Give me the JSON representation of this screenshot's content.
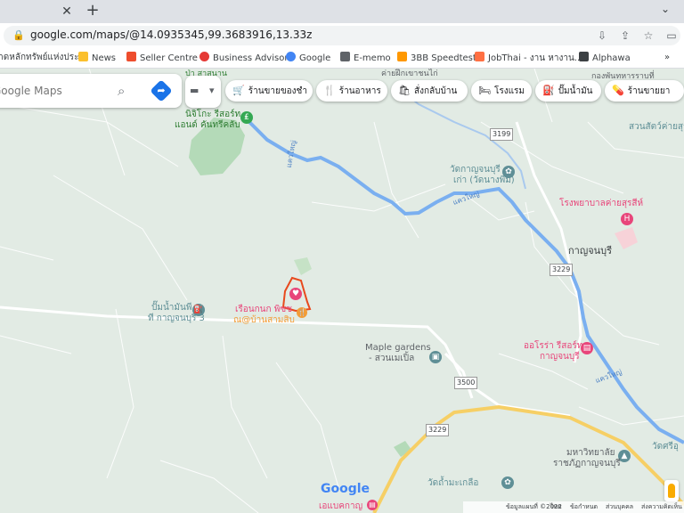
{
  "browser": {
    "tab_close_icon": "close-icon",
    "new_tab_label": "+",
    "tab_menu_label": "⌄",
    "url": "google.com/maps/@14.0935345,99.3683916,13.33z"
  },
  "bookmarks": [
    {
      "label": "ลาดหลักทรัพย์แห่งประ...",
      "color": "#1a73e8"
    },
    {
      "label": "News",
      "color": "#fbc02d"
    },
    {
      "label": "Seller Centre",
      "color": "#ee4d2d"
    },
    {
      "label": "Business Advisor",
      "color": "#e53935"
    },
    {
      "label": "Google",
      "color": "#4285f4"
    },
    {
      "label": "E-memo",
      "color": "#5f6368"
    },
    {
      "label": "3BB Speedtest",
      "color": "#ff9800"
    },
    {
      "label": "JobThai - งาน หางาน...",
      "color": "#ff7043"
    },
    {
      "label": "Alphawa",
      "color": "#3c4043"
    }
  ],
  "bookmarks_more": "»",
  "search": {
    "placeholder": "Google Maps"
  },
  "keyboard": {
    "label": "▬",
    "caret": "▾"
  },
  "chips": [
    {
      "label": "ร้านขายของชำ",
      "icon": "🛒"
    },
    {
      "label": "ร้านอาหาร",
      "icon": "🍴"
    },
    {
      "label": "สั่งกลับบ้าน",
      "icon": "🛍"
    },
    {
      "label": "โรงแรม",
      "icon": "🛏"
    },
    {
      "label": "ปั๊มน้ำมัน",
      "icon": "⛽"
    },
    {
      "label": "ร้านขายยา",
      "icon": "💊"
    }
  ],
  "map_labels": {
    "nichiko_1": "นิจิโกะ รีสอร์ท",
    "nichiko_2": "แอนด์ คันทรีคลับ",
    "river_1": "แควใหญ่",
    "river_2": "แควใหญ่",
    "river_3": "แควใหญ่",
    "wat_1": "วัดกาญจนบุรี",
    "wat_2": "เก่า (วัดนางพิม)",
    "camp": "ค่ายฝึกเขาชนไก่",
    "reg": "กองพันทหารราบที่",
    "zoo": "สวนสัตว์ค่ายสุร",
    "hospital": "โรงพยาบาลค่ายสุรสีห์",
    "town": "กาญจนบุรี",
    "pump_1": "ปั๊มน้ำมันพี",
    "pump_2": "ที กาญจนบุรี 3",
    "home_1": "เรือนกนก พิซซ",
    "home_2": "ณ@บ้านสามสิบ",
    "maple_1": "Maple gardens",
    "maple_2": "- สวนเมเปิ้ล",
    "aura_1": "ออโรร่า รีสอร์ท",
    "aura_2": "กาญจนบุรี",
    "uni_1": "มหาวิทยาลัย",
    "uni_2": "ราชภัฏกาญจนบุรี",
    "wat_thammakhelo": "วัดถ้ำมะเกลือ",
    "wat_sri": "วัดศรีอุ",
    "top_partial": "ป่า สาสนาน",
    "bottom_partial": "เอแบคกาญ",
    "road_3199": "3199",
    "road_3229_a": "3229",
    "road_3500": "3500",
    "road_3229_b": "3229"
  },
  "google_logo": "Google",
  "footer": {
    "data": "ข้อมูลแผนที่ ©2022",
    "thai": "ไทย",
    "terms": "ข้อกำหนด",
    "privacy": "ส่วนบุคคล",
    "feedback": "ส่งความคิดเห็น"
  },
  "colors": {
    "map_bg": "#e2ebe4",
    "river": "#6fa8f0",
    "road_yellow": "#f6cf65",
    "poi_teal": "#5f8f96",
    "hotel_pink": "#e8457a",
    "food_orange": "#f29d38",
    "park_green": "#34a853",
    "highlight": "#e8491d"
  }
}
